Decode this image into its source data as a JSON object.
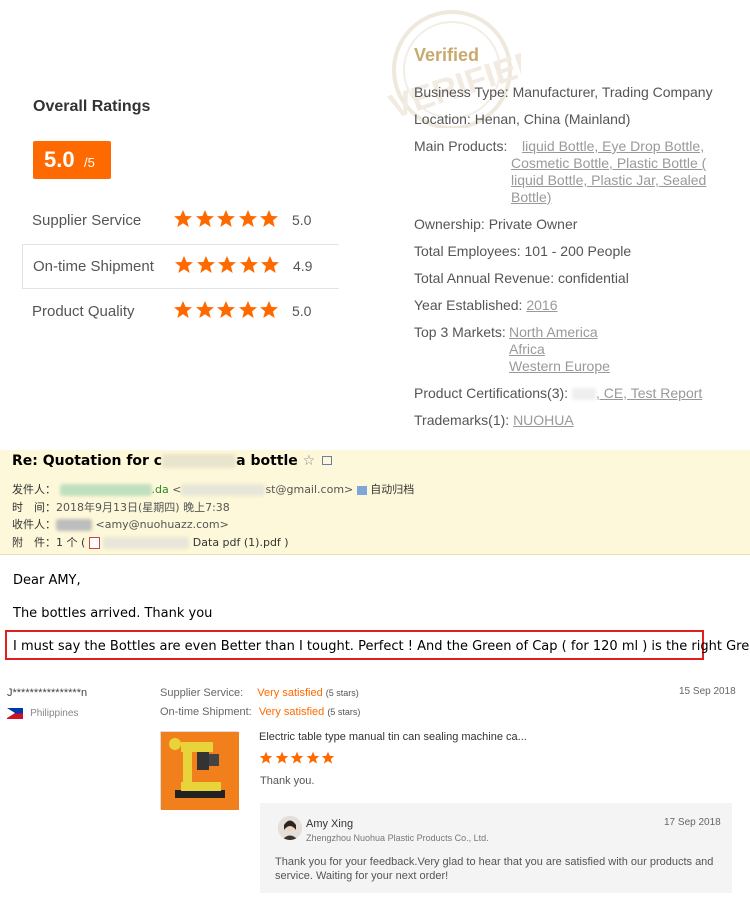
{
  "ratings": {
    "title": "Overall Ratings",
    "score": "5.0",
    "score_max": "/5",
    "accent": "#ff6a00",
    "rows": [
      {
        "label": "Supplier Service",
        "value": "5.0",
        "stars": 5
      },
      {
        "label": "On-time Shipment",
        "value": "4.9",
        "stars": 5
      },
      {
        "label": "Product Quality",
        "value": "5.0",
        "stars": 5
      }
    ]
  },
  "verified": {
    "title": "Verified",
    "stamp_text": "VERIFIED",
    "business_type_label": "Business Type:",
    "business_type": "Manufacturer, Trading Company",
    "location_label": "Location:",
    "location": "Henan, China (Mainland)",
    "main_products_label": "Main Products:",
    "main_products_lines": [
      "liquid Bottle, Eye Drop Bottle,",
      "Cosmetic Bottle, Plastic Bottle (",
      "liquid Bottle, Plastic Jar, Sealed",
      "Bottle)"
    ],
    "ownership_label": "Ownership:",
    "ownership": "Private Owner",
    "employees_label": "Total Employees:",
    "employees": "101 - 200 People",
    "revenue_label": "Total Annual Revenue:",
    "revenue": "confidential",
    "year_label": "Year Established:",
    "year": "2016",
    "markets_label": "Top 3 Markets:",
    "markets": [
      "North America",
      "Africa",
      "Western Europe"
    ],
    "certs_label": "Product Certifications(3):",
    "certs": ", CE, Test Report",
    "trademarks_label": "Trademarks(1):",
    "trademarks": "NUOHUA"
  },
  "email": {
    "subject_start": "Re: Quotation for c",
    "subject_end": "a bottle",
    "from_label": "发件人：",
    "from_visible": ".da",
    "from_addr": "st@gmail.com>",
    "auto_archive": "自动归档",
    "time_label": "时　间：",
    "time": "2018年9月13日(星期四) 晚上7:38",
    "to_label": "收件人：",
    "to_addr": "<amy@nuohuazz.com>",
    "attach_label": "附　件：",
    "attach_count": "1 个 (",
    "attach_name": "Data pdf  (1).pdf )",
    "greeting": "Dear AMY,",
    "line1": "The bottles arrived. Thank you",
    "line2": "I must say the Bottles are even Better than I tought. Perfect ! And the Green of Cap ( for 120 ml ) is the right Green."
  },
  "review": {
    "user": "J****************n",
    "country": "Philippines",
    "supplier_service_label": "Supplier Service:",
    "supplier_service_value": "Very satisfied",
    "supplier_service_stars": "(5 stars)",
    "shipment_label": "On-time Shipment:",
    "shipment_value": "Very satisfied",
    "shipment_stars": "(5 stars)",
    "date": "15 Sep 2018",
    "product_title": "Electric table type manual tin can sealing machine ca...",
    "rating_stars": 5,
    "comment": "Thank you.",
    "reply": {
      "name": "Amy Xing",
      "company": "Zhengzhou Nuohua Plastic Products Co., Ltd.",
      "date": "17 Sep 2018",
      "text_line1": "Thank you for your feedback.Very glad to hear that you are satisfied with our products and",
      "text_line2": "service. Waiting for your next order!"
    }
  }
}
